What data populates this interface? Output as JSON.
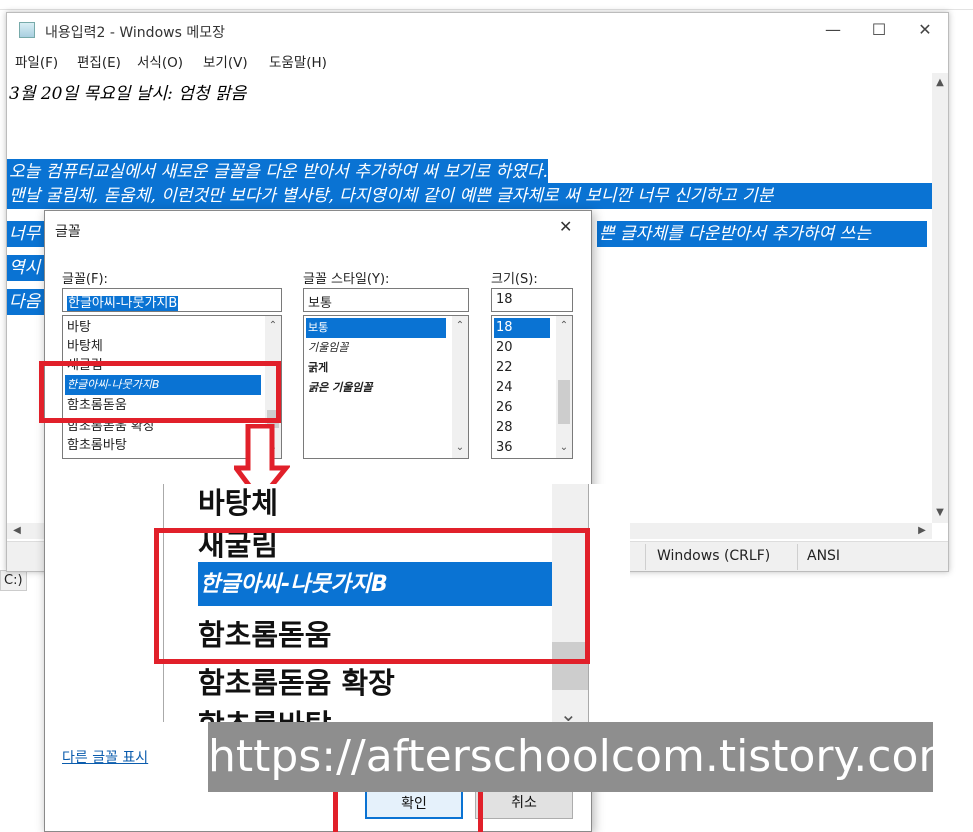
{
  "notepad": {
    "title": "내용입력2 - Windows 메모장",
    "win_min": "—",
    "win_max": "☐",
    "win_close": "✕",
    "menus": [
      "파일(F)",
      "편집(E)",
      "서식(O)",
      "보기(V)",
      "도움말(H)"
    ],
    "lines": [
      "3월 20일 목요일 날시: 엄청 맑음",
      "",
      "오늘 컴퓨터교실에서 새로운 글꼴을 다운 받아서 추가하여 써 보기로 하였다.",
      "맨날 굴림체, 돋움체, 이런것만 보다가 별사탕, 다지영이체 같이 예쁜 글자체로 써 보니깐 너무 신기하고 기분",
      "너무",
      "역시",
      "다음"
    ],
    "line3_right": "쁜 글자체를 다운받아서 추가하여 쓰는",
    "status": {
      "eol": "Windows (CRLF)",
      "encoding": "ANSI"
    }
  },
  "dialog": {
    "title": "글꼴",
    "close": "✕",
    "font_label": "글꼴(F):",
    "font_value": "한글아씨-나뭇가지B",
    "font_items": [
      "바탕",
      "바탕체",
      "새굴림",
      "한글아씨-나뭇가지B",
      "함초롬돋움",
      "함초롬돋움 확장",
      "함초롬바탕"
    ],
    "font_selected_index": 3,
    "style_label": "글꼴 스타일(Y):",
    "style_value": "보통",
    "style_items": [
      "보통",
      "기울임꼴",
      "굵게",
      "굵은 기울임꼴"
    ],
    "size_label": "크기(S):",
    "size_value": "18",
    "size_items": [
      "18",
      "20",
      "22",
      "24",
      "26",
      "28",
      "36"
    ],
    "more_fonts": "다른 글꼴 표시",
    "ok": "확인",
    "cancel": "취소"
  },
  "zoom": {
    "items": [
      "바탕체",
      "새굴림",
      "한글아씨-나뭇가지B",
      "함초롬돋움",
      "함초롬돋움 확장",
      "함초롬바탕"
    ]
  },
  "side_fragment": "C:)",
  "watermark": "https://afterschoolcom.tistory.com",
  "colors": {
    "selection": "#0a73d3",
    "highlight_box": "#e1202a",
    "watermark_bg": "#8e8e8e"
  }
}
